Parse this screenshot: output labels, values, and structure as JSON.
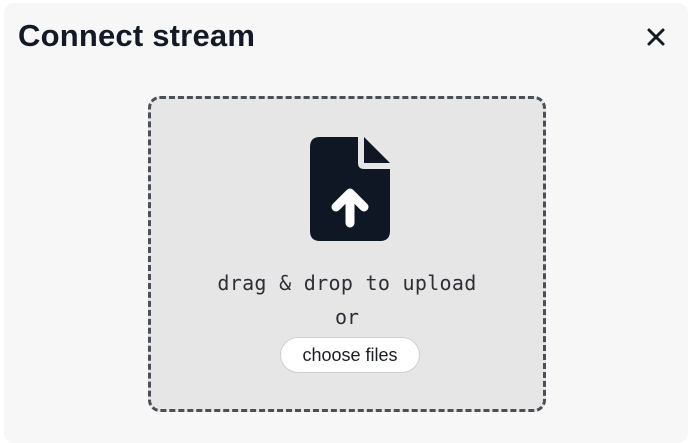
{
  "dialog": {
    "title": "Connect stream",
    "close_icon": "close-icon"
  },
  "upload": {
    "icon": "file-upload-icon",
    "drop_text": "drag & drop to upload",
    "or_text": "or",
    "choose_label": "choose files"
  },
  "colors": {
    "title": "#131a26",
    "icon": "#0f1724",
    "dropzone_bg": "#e6e6e6",
    "dropzone_border": "#4a4f58",
    "modal_bg": "#f7f7f7"
  }
}
